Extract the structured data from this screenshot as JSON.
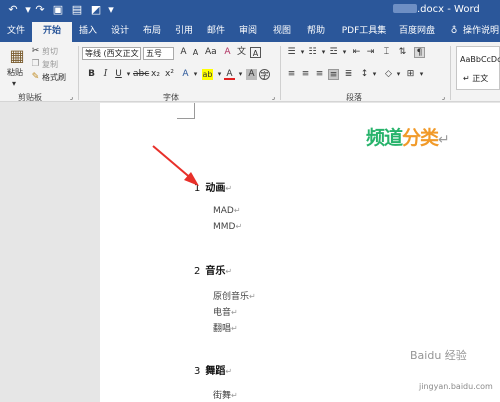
{
  "titlebar": {
    "title_prefix": "",
    "title_suffix": ".docx - Word"
  },
  "tabs": [
    {
      "label": "文件"
    },
    {
      "label": "开始"
    },
    {
      "label": "插入"
    },
    {
      "label": "设计"
    },
    {
      "label": "布局"
    },
    {
      "label": "引用"
    },
    {
      "label": "邮件"
    },
    {
      "label": "审阅"
    },
    {
      "label": "视图"
    },
    {
      "label": "帮助"
    },
    {
      "label": "PDF工具集"
    },
    {
      "label": "百度网盘"
    },
    {
      "label": "操作说明"
    }
  ],
  "clipboard": {
    "paste": "粘贴",
    "cut": "剪切",
    "copy": "复制",
    "format_painter": "格式刷",
    "group": "剪贴板"
  },
  "font": {
    "family": "等线 (西文正文",
    "size": "五号",
    "group": "字体"
  },
  "paragraph": {
    "group": "段落"
  },
  "styles": {
    "sample": "AaBbCcDc",
    "name": "正文"
  },
  "watermark": {
    "part1": "频道",
    "part2": "分类"
  },
  "document": {
    "sections": [
      {
        "num": "1",
        "title": "动画",
        "items": [
          "MAD",
          "MMD"
        ]
      },
      {
        "num": "2",
        "title": "音乐",
        "items": [
          "原创音乐",
          "电音",
          "翻唱"
        ]
      },
      {
        "num": "3",
        "title": "舞蹈",
        "items": [
          "街舞"
        ]
      }
    ],
    "para_mark": "↵"
  },
  "baidu_watermark": {
    "brand": "Baidu 经验",
    "url": "jingyan.baidu.com"
  }
}
